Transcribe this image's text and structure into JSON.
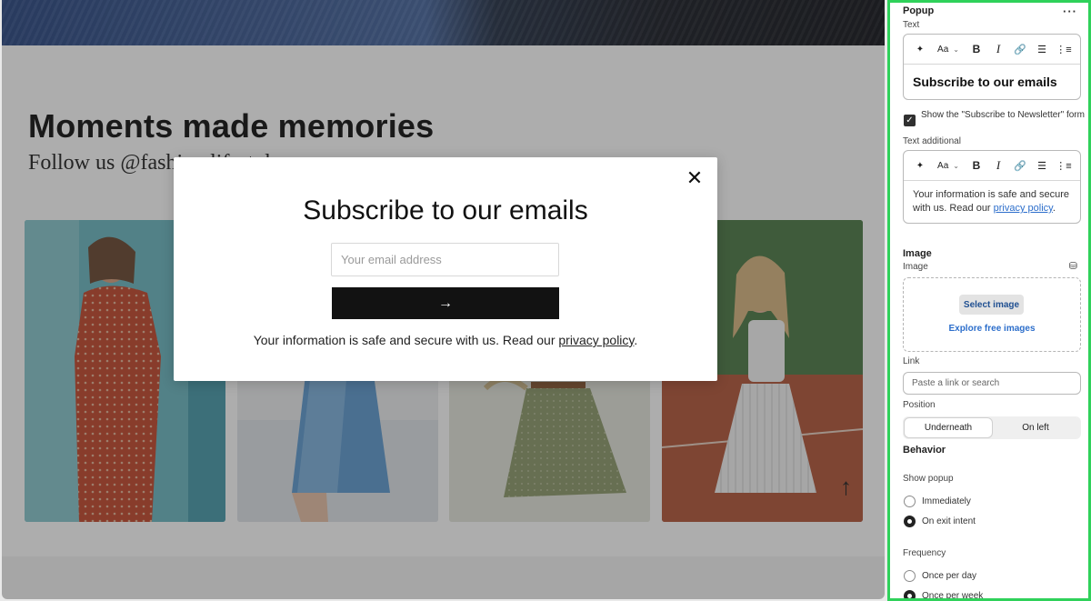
{
  "preview": {
    "section_title": "Moments made memories",
    "section_subtitle": "Follow us @fashion.lifestyle",
    "scroll_top_glyph": "↑"
  },
  "popup": {
    "close_glyph": "✕",
    "title": "Subscribe to our emails",
    "email_placeholder": "Your email address",
    "submit_glyph": "→",
    "note_text": "Your information is safe and secure with us. Read our ",
    "note_link": "privacy policy",
    "note_end": "."
  },
  "panel": {
    "section_popup": "Popup",
    "more_glyph": "···",
    "label_text": "Text",
    "toolbar": {
      "magic_glyph": "✦",
      "size_label": "Aa",
      "chevron_glyph": "⌄",
      "bold_label": "B",
      "italic_label": "I",
      "link_glyph": "🔗",
      "list_glyph": "☰",
      "olist_glyph": "⋮≡"
    },
    "text_value": "Subscribe to our emails",
    "checkbox_glyph": "✓",
    "checkbox_label": "Show the \"Subscribe to Newsletter\" form",
    "checkbox_checked": true,
    "label_text_additional": "Text additional",
    "text_additional_value": "Your information is safe and secure with us. Read our ",
    "text_additional_link": "privacy policy",
    "text_additional_end": ".",
    "section_image": "Image",
    "label_image": "Image",
    "db_glyph": "⛁",
    "select_image_label": "Select image",
    "explore_images_label": "Explore free images",
    "label_link": "Link",
    "link_placeholder": "Paste a link or search",
    "label_position": "Position",
    "position_options": [
      "Underneath",
      "On left"
    ],
    "position_selected": "Underneath",
    "section_behavior": "Behavior",
    "label_show_popup": "Show popup",
    "show_popup_options": [
      "Immediately",
      "On exit intent"
    ],
    "show_popup_selected": "On exit intent",
    "label_frequency": "Frequency",
    "frequency_options": [
      "Once per day",
      "Once per week"
    ],
    "frequency_selected": "Once per week",
    "colors": {
      "panel_border": "#2fd15a",
      "link_blue": "#2c6ecb",
      "button_dark": "#121212"
    }
  }
}
